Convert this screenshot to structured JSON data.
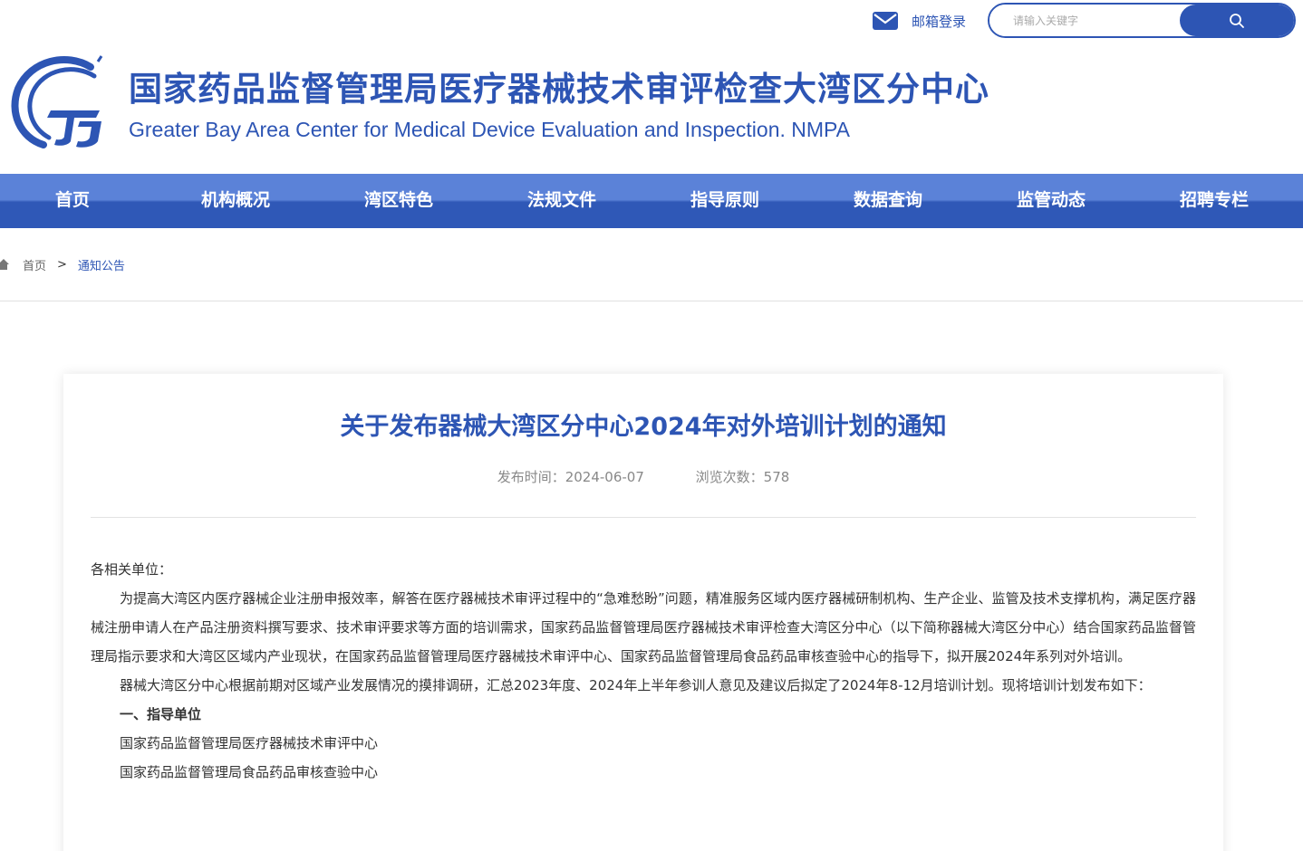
{
  "topbar": {
    "mail_login": "邮箱登录",
    "search_placeholder": "请输入关键字"
  },
  "header": {
    "title": "国家药品监督管理局医疗器械技术审评检查大湾区分中心",
    "subtitle": "Greater Bay Area Center for Medical Device Evaluation and Inspection. NMPA"
  },
  "nav": {
    "items": [
      {
        "label": "首页"
      },
      {
        "label": "机构概况"
      },
      {
        "label": "湾区特色"
      },
      {
        "label": "法规文件"
      },
      {
        "label": "指导原则"
      },
      {
        "label": "数据查询"
      },
      {
        "label": "监管动态"
      },
      {
        "label": "招聘专栏"
      }
    ]
  },
  "breadcrumb": {
    "home": "首页",
    "separator": ">",
    "current": "通知公告"
  },
  "article": {
    "title": "关于发布器械大湾区分中心2024年对外培训计划的通知",
    "publish_time": "发布时间：2024-06-07",
    "views": "浏览次数：578",
    "paragraphs": [
      "各相关单位：",
      "为提高大湾区内医疗器械企业注册申报效率，解答在医疗器械技术审评过程中的“急难愁盼”问题，精准服务区域内医疗器械研制机构、生产企业、监管及技术支撑机构，满足医疗器械注册申请人在产品注册资料撰写要求、技术审评要求等方面的培训需求，国家药品监督管理局医疗器械技术审评检查大湾区分中心（以下简称器械大湾区分中心）结合国家药品监督管理局指示要求和大湾区区域内产业现状，在国家药品监督管理局医疗器械技术审评中心、国家药品监督管理局食品药品审核查验中心的指导下，拟开展2024年系列对外培训。",
      "器械大湾区分中心根据前期对区域产业发展情况的摸排调研，汇总2023年度、2024年上半年参训人意见及建议后拟定了2024年8-12月培训计划。现将培训计划发布如下：",
      "一、指导单位",
      "国家药品监督管理局医疗器械技术审评中心",
      "国家药品监督管理局食品药品审核查验中心"
    ]
  },
  "colors": {
    "brand": "#2d55b4",
    "nav_top": "#5b82d8",
    "nav_bottom": "#2f58b7"
  }
}
